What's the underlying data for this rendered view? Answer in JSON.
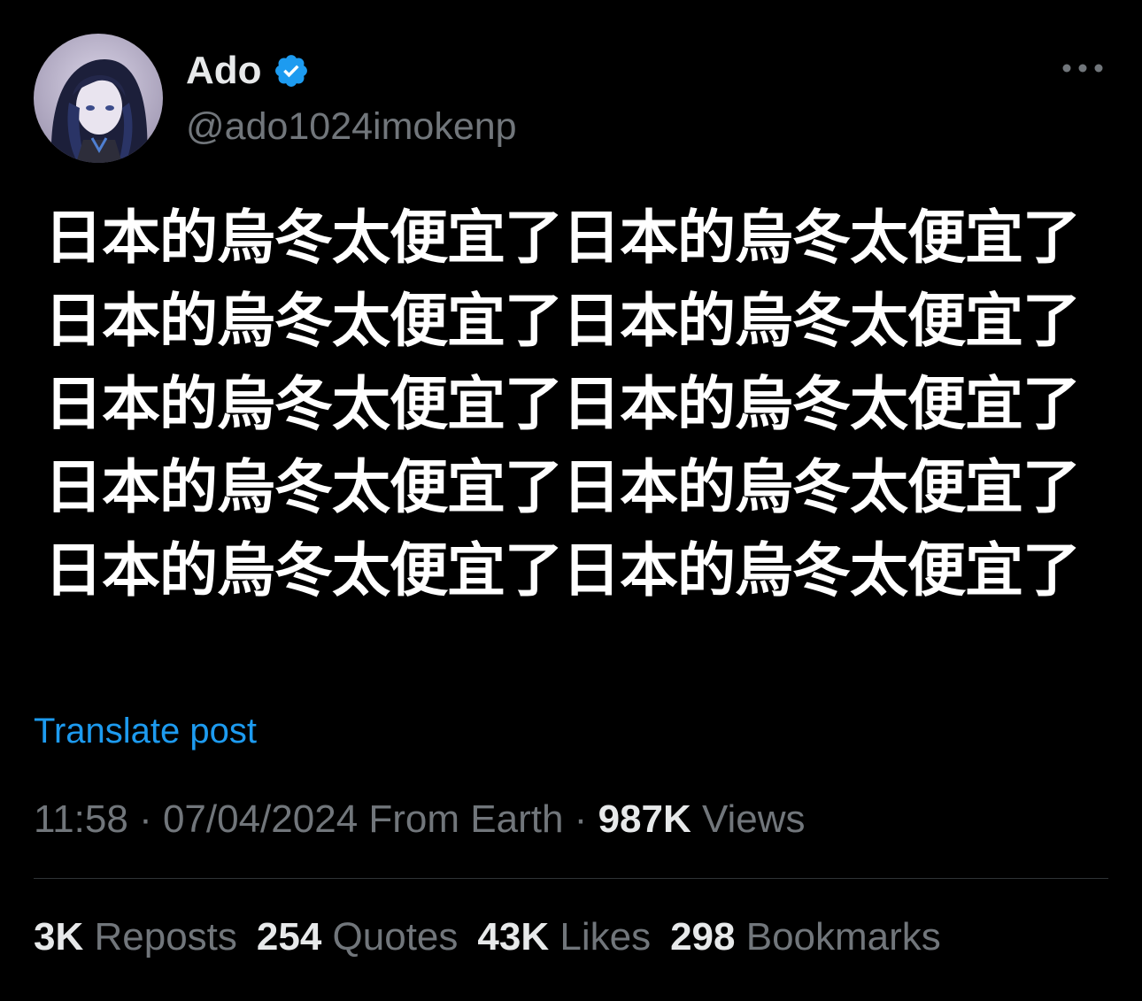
{
  "author": {
    "display_name": "Ado",
    "handle": "@ado1024imokenp",
    "verified": true,
    "verified_color": "#1d9bf0"
  },
  "post": {
    "text_lines": [
      "日本的烏冬太便宜了日本的烏冬太便宜了",
      "日本的烏冬太便宜了日本的烏冬太便宜了",
      "日本的烏冬太便宜了日本的烏冬太便宜了",
      "日本的烏冬太便宜了日本的烏冬太便宜了",
      "日本的烏冬太便宜了日本的烏冬太便宜了"
    ],
    "translate_label": "Translate post"
  },
  "meta": {
    "time": "11:58",
    "sep1": " · ",
    "date": "07/04/2024",
    "location": " From Earth",
    "sep2": " · ",
    "views_count": "987K",
    "views_label": " Views"
  },
  "stats": {
    "reposts_count": "3K",
    "reposts_label": " Reposts",
    "quotes_count": "254",
    "quotes_label": " Quotes",
    "likes_count": "43K",
    "likes_label": " Likes",
    "bookmarks_count": "298",
    "bookmarks_label": " Bookmarks"
  },
  "icons": {
    "avatar": "avatar-illustration",
    "verified": "verified-badge-icon",
    "more": "more-options-icon"
  },
  "colors": {
    "background": "#000000",
    "primary_text": "#e7e9ea",
    "secondary_text": "#71767b",
    "link": "#1d9bf0",
    "divider": "#2f3336"
  }
}
